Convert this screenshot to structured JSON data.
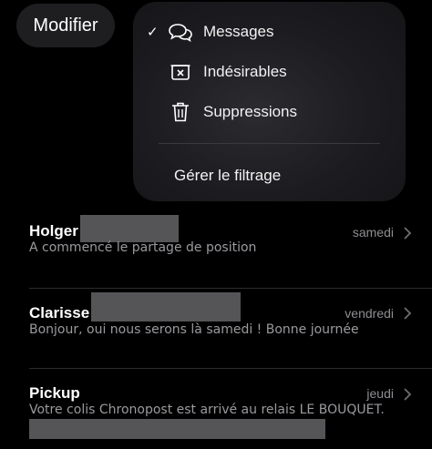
{
  "header": {
    "edit_label": "Modifier"
  },
  "menu": {
    "items": [
      {
        "label": "Messages",
        "checked": true,
        "icon": "chat-bubbles-icon"
      },
      {
        "label": "Indésirables",
        "checked": false,
        "icon": "junk-tray-icon"
      },
      {
        "label": "Suppressions",
        "checked": false,
        "icon": "trash-icon"
      }
    ],
    "check_glyph": "✓",
    "action_label": "Gérer le filtrage"
  },
  "conversations": [
    {
      "name": "Holger",
      "date": "samedi",
      "preview": "A commencé le partage de position"
    },
    {
      "name": "Clarisse",
      "date": "vendredi",
      "preview": "Bonjour, oui nous serons là samedi ! Bonne journée"
    },
    {
      "name": "Pickup",
      "date": "jeudi",
      "preview": "Votre colis Chronopost est arrivé au relais LE BOUQUET."
    }
  ],
  "colors": {
    "background": "#000000",
    "menu": "#1c1c20",
    "redaction": "#555557",
    "secondary_text": "#8e8e93"
  }
}
